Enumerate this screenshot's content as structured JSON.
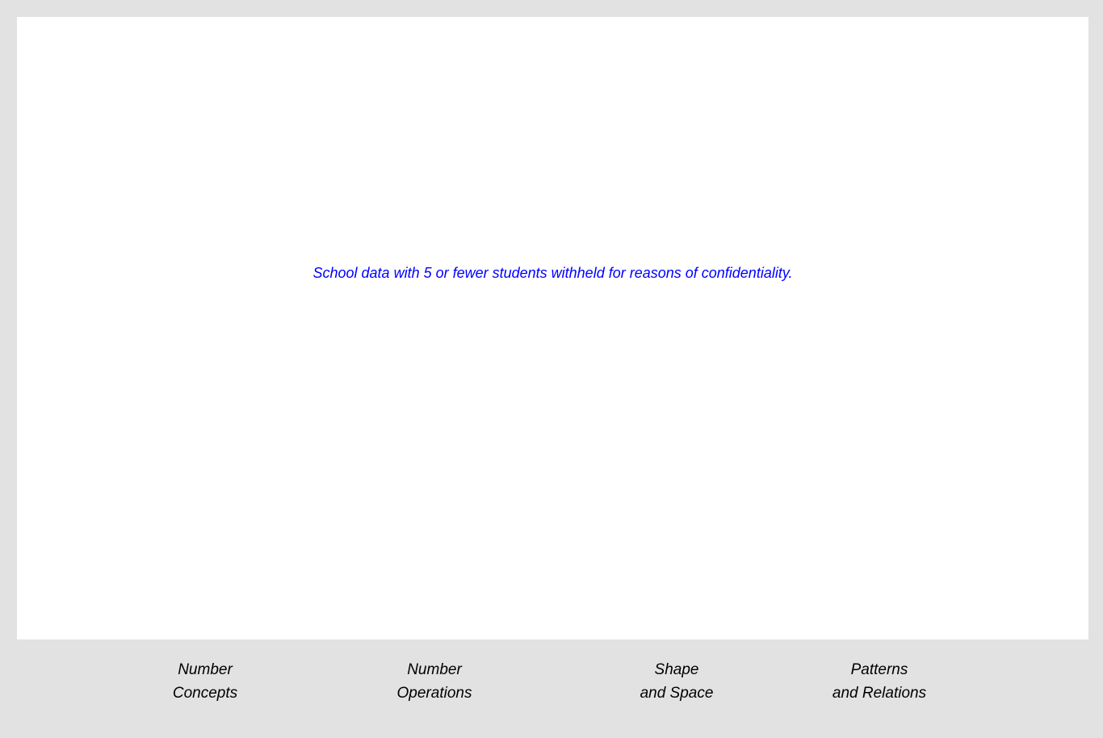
{
  "chart_data": {
    "type": "bar",
    "categories": [
      [
        "Number",
        "Concepts"
      ],
      [
        "Number",
        "Operations"
      ],
      [
        "Shape",
        "and Space"
      ],
      [
        "Patterns",
        "and Relations"
      ]
    ],
    "values": [],
    "notice": "School data with 5 or fewer students withheld for reasons of confidentiality.",
    "grid": false,
    "legend": "none"
  },
  "colors": {
    "background": "#e2e2e2",
    "plot_background": "#ffffff",
    "notice_text": "#0000ff",
    "label_text": "#000000"
  }
}
